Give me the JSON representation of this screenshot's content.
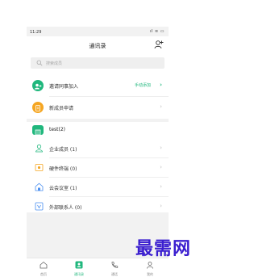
{
  "status_bar": {
    "time": "11:29",
    "indicators": "ıl ≋ ▭"
  },
  "header": {
    "title": "通讯录"
  },
  "search": {
    "placeholder": "搜索成员"
  },
  "actions": [
    {
      "label": "邀请同事加入",
      "link": "手动添加"
    },
    {
      "label": "新成员申请"
    }
  ],
  "group": {
    "name": "test(2)",
    "items": [
      {
        "label": "企业成员 (1)",
        "icon": "person-icon"
      },
      {
        "label": "硬件终端 (0)",
        "icon": "device-icon"
      },
      {
        "label": "云会议室 (1)",
        "icon": "room-icon"
      },
      {
        "label": "外部联系人 (0)",
        "icon": "external-contact-icon"
      }
    ]
  },
  "tabs": [
    {
      "label": "首页",
      "icon": "home-icon"
    },
    {
      "label": "通讯录",
      "icon": "contacts-icon",
      "active": true
    },
    {
      "label": "通话",
      "icon": "phone-icon"
    },
    {
      "label": "我的",
      "icon": "profile-icon"
    }
  ],
  "watermark": "最需网",
  "colors": {
    "accent": "#20b77d",
    "orange": "#f5a623",
    "blue_icon": "#4a8ff0",
    "watermark": "#3a1ecf"
  }
}
